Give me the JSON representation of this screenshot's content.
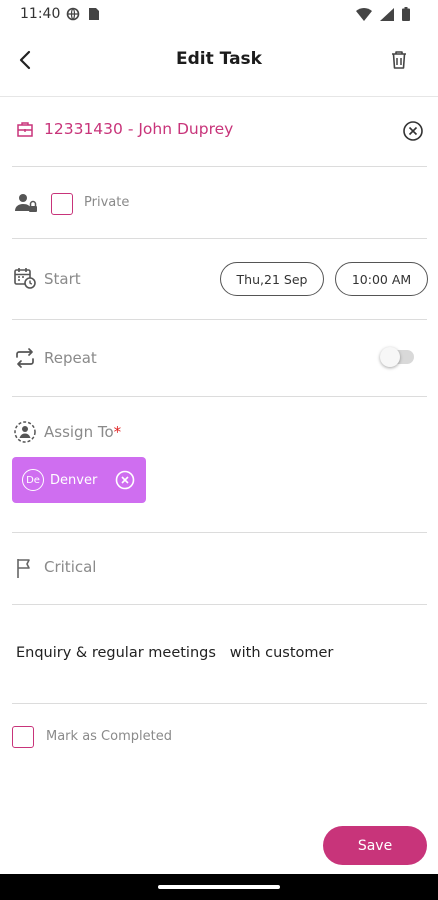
{
  "status_bar": {
    "time": "11:40"
  },
  "header": {
    "title": "Edit Task",
    "back_icon": "back-arrow-icon",
    "delete_icon": "trash-icon"
  },
  "customer": {
    "id": "12331430",
    "separator": " - ",
    "name": "John Duprey",
    "color": "#c8347a"
  },
  "privacy": {
    "label": "Private",
    "checked": false
  },
  "start": {
    "label": "Start",
    "date": "Thu,21 Sep",
    "time": "10:00 AM"
  },
  "repeat": {
    "label": "Repeat",
    "enabled": false
  },
  "assign": {
    "label": "Assign To",
    "required_mark": "*",
    "assignees": [
      {
        "initials": "De",
        "name": "Denver",
        "chip_color": "#cf6ef0"
      }
    ]
  },
  "critical": {
    "label": "Critical"
  },
  "description": {
    "value": "Enquiry & regular meetings   with customer"
  },
  "completed": {
    "label": "Mark as Completed",
    "checked": false
  },
  "actions": {
    "save_label": "Save",
    "accent": "#c8347a"
  }
}
